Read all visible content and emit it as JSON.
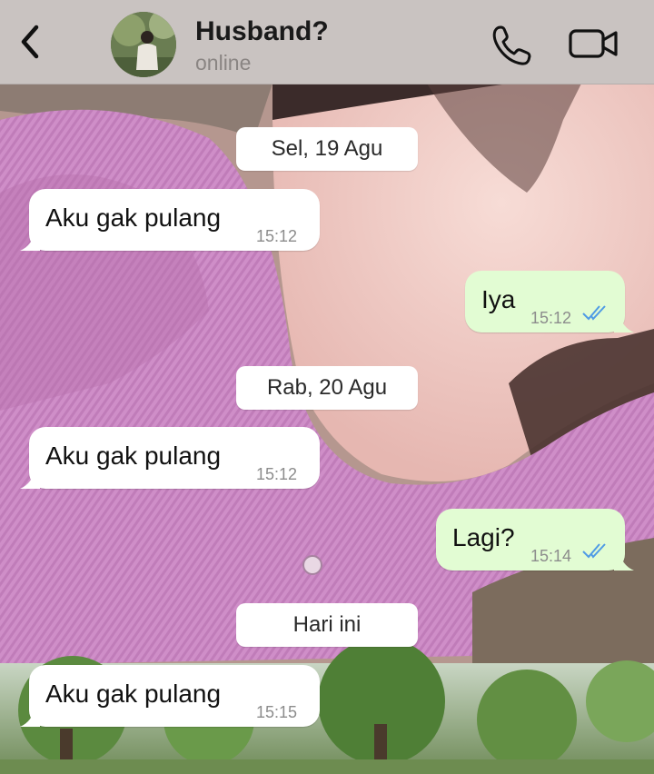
{
  "header": {
    "contact_name": "Husband?",
    "status": "online",
    "icons": [
      "chevron-left-icon",
      "avatar",
      "phone-icon",
      "video-camera-icon"
    ]
  },
  "messages": [
    {
      "type": "date",
      "label": "Sel, 19 Agu"
    },
    {
      "type": "incoming",
      "text": "Aku gak pulang",
      "time": "15:12"
    },
    {
      "type": "outgoing",
      "text": "Iya",
      "time": "15:12",
      "read": true
    },
    {
      "type": "date",
      "label": "Rab, 20 Agu"
    },
    {
      "type": "incoming",
      "text": "Aku gak pulang",
      "time": "15:12"
    },
    {
      "type": "outgoing",
      "text": "Lagi?",
      "time": "15:14",
      "read": true
    },
    {
      "type": "date",
      "label": "Hari ini"
    },
    {
      "type": "incoming",
      "text": "Aku gak pulang",
      "time": "15:15"
    }
  ],
  "colors": {
    "outgoing_bubble": "#e2fcd3",
    "incoming_bubble": "#ffffff",
    "read_ticks": "#4f9be5",
    "header_bg": "#c9c3c1"
  }
}
